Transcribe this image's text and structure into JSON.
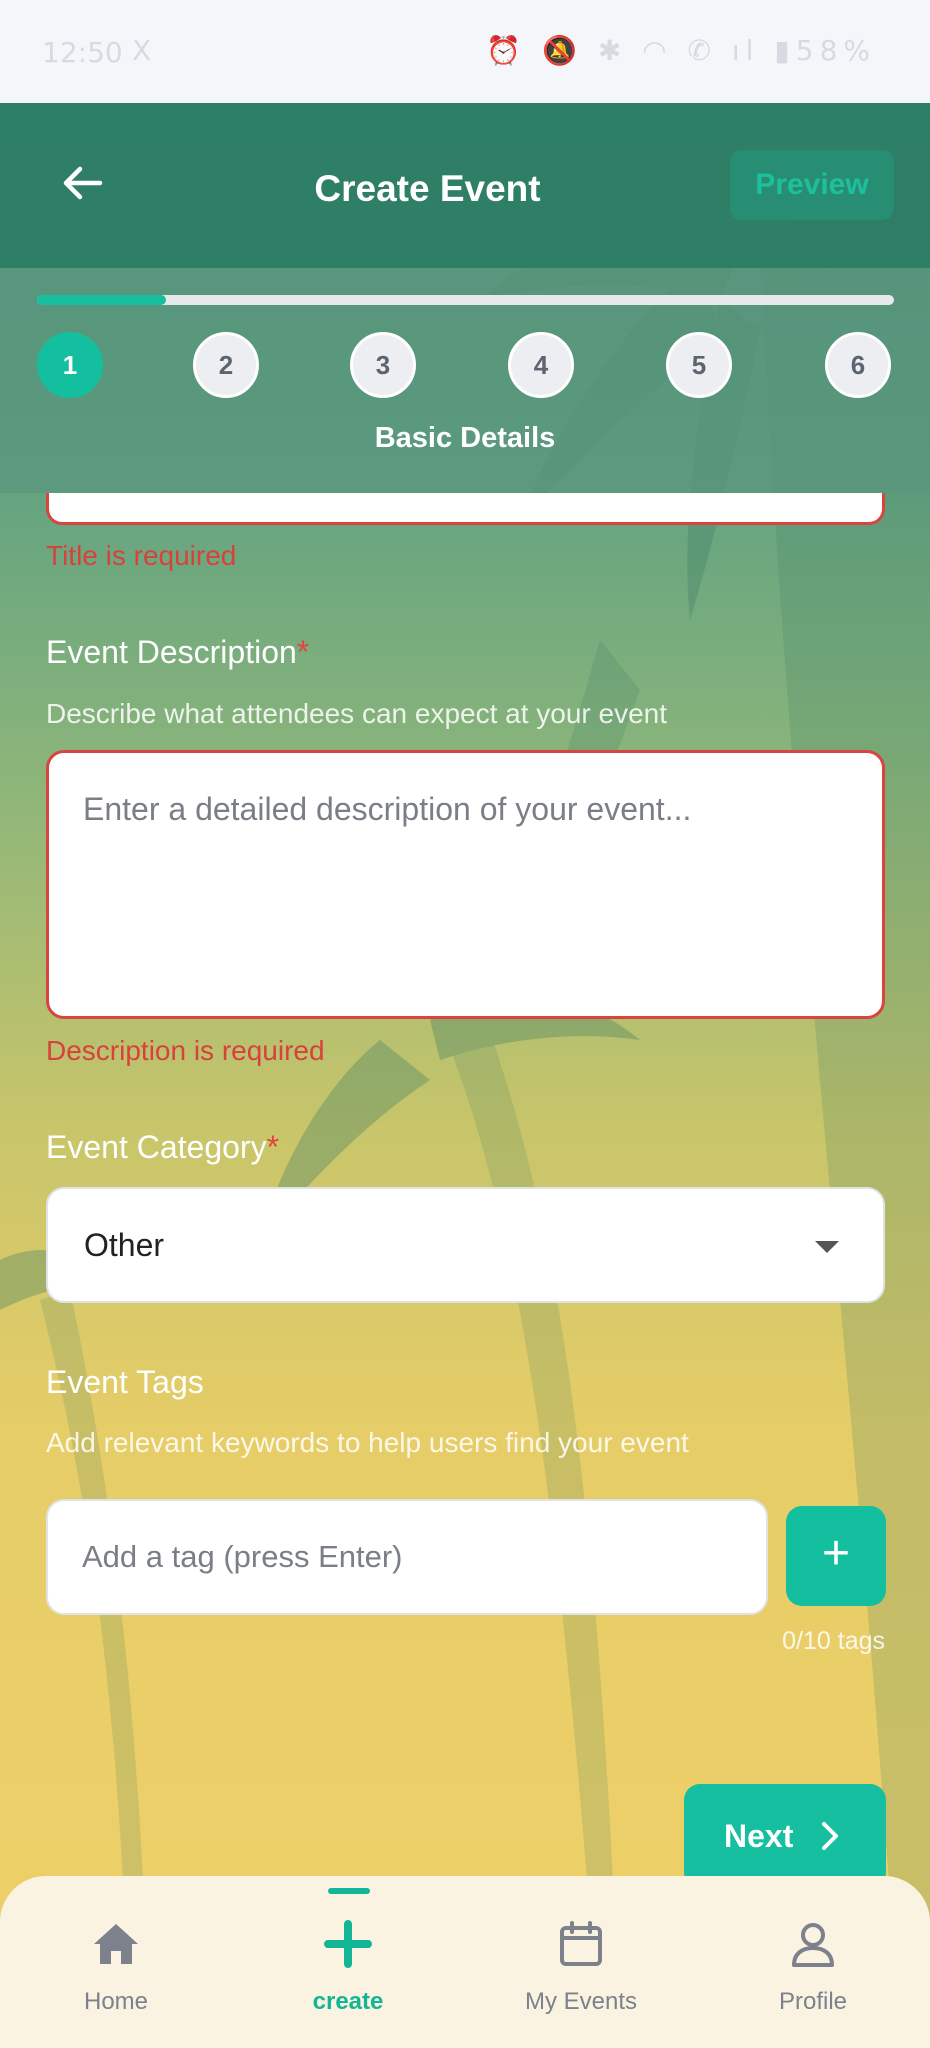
{
  "status_bar": {
    "time": "12:50",
    "x": "X",
    "icons": "⏰ 🔕 ✱ ◠ ✆ ıl ▮58%"
  },
  "header": {
    "title": "Create Event",
    "preview_label": "Preview"
  },
  "stepper": {
    "progress_percent": 15,
    "steps": [
      "1",
      "2",
      "3",
      "4",
      "5",
      "6"
    ],
    "active_step_index": 0,
    "active_label": "Basic Details"
  },
  "title_field": {
    "error": "Title is required"
  },
  "description": {
    "label": "Event Description",
    "required_marker": "*",
    "help": "Describe what attendees can expect at your event",
    "placeholder": "Enter a detailed description of your event...",
    "error": "Description is required"
  },
  "category": {
    "label": "Event Category",
    "required_marker": "*",
    "selected": "Other"
  },
  "tags": {
    "label": "Event Tags",
    "help": "Add relevant keywords to help users find your event",
    "placeholder": "Add a tag (press Enter)",
    "add_label": "+",
    "count": "0/10 tags"
  },
  "next_label": "Next",
  "bottom_nav": [
    {
      "label": "Home",
      "icon": "home-icon"
    },
    {
      "label": "create",
      "icon": "plus-icon"
    },
    {
      "label": "My Events",
      "icon": "calendar-icon"
    },
    {
      "label": "Profile",
      "icon": "profile-icon"
    }
  ],
  "active_nav_index": 1,
  "colors": {
    "accent": "#14bf9f",
    "error": "#d9443f",
    "header": "#2b7d64"
  }
}
